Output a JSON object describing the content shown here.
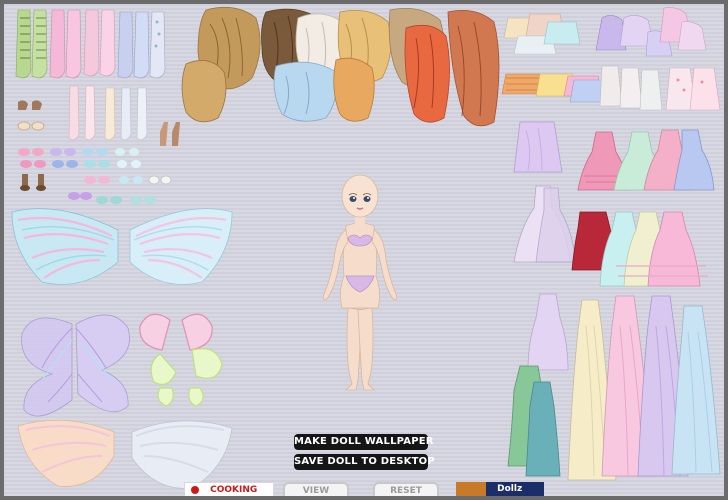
{
  "buttons": {
    "make_wallpaper": "MAKE DOLL WALLPAPER",
    "save_to_desktop": "SAVE DOLL TO DESKTOP",
    "view": "VIEW",
    "reset": "RESET"
  },
  "ads": {
    "cooking": "COOKING",
    "dollz": "Dollz"
  },
  "colors": {
    "frame": "#6b6b6b",
    "stage": "#d4d5df",
    "button_bg": "#151515",
    "button_text": "#ffffff",
    "skin": "#f6dcca",
    "bikini": "#d9b8e8",
    "ad_red": "#d01818",
    "ad_navy": "#1c2e6a"
  },
  "icons": {
    "tights": "tights-icon",
    "shoes": "shoe-icon",
    "hair": "hair-icon",
    "wings": "wings-icon",
    "fairy_wings": "fairy-wings-icon",
    "tops": "top-icon",
    "dresses": "dress-icon",
    "gowns": "gown-icon",
    "doll": "doll-icon"
  }
}
